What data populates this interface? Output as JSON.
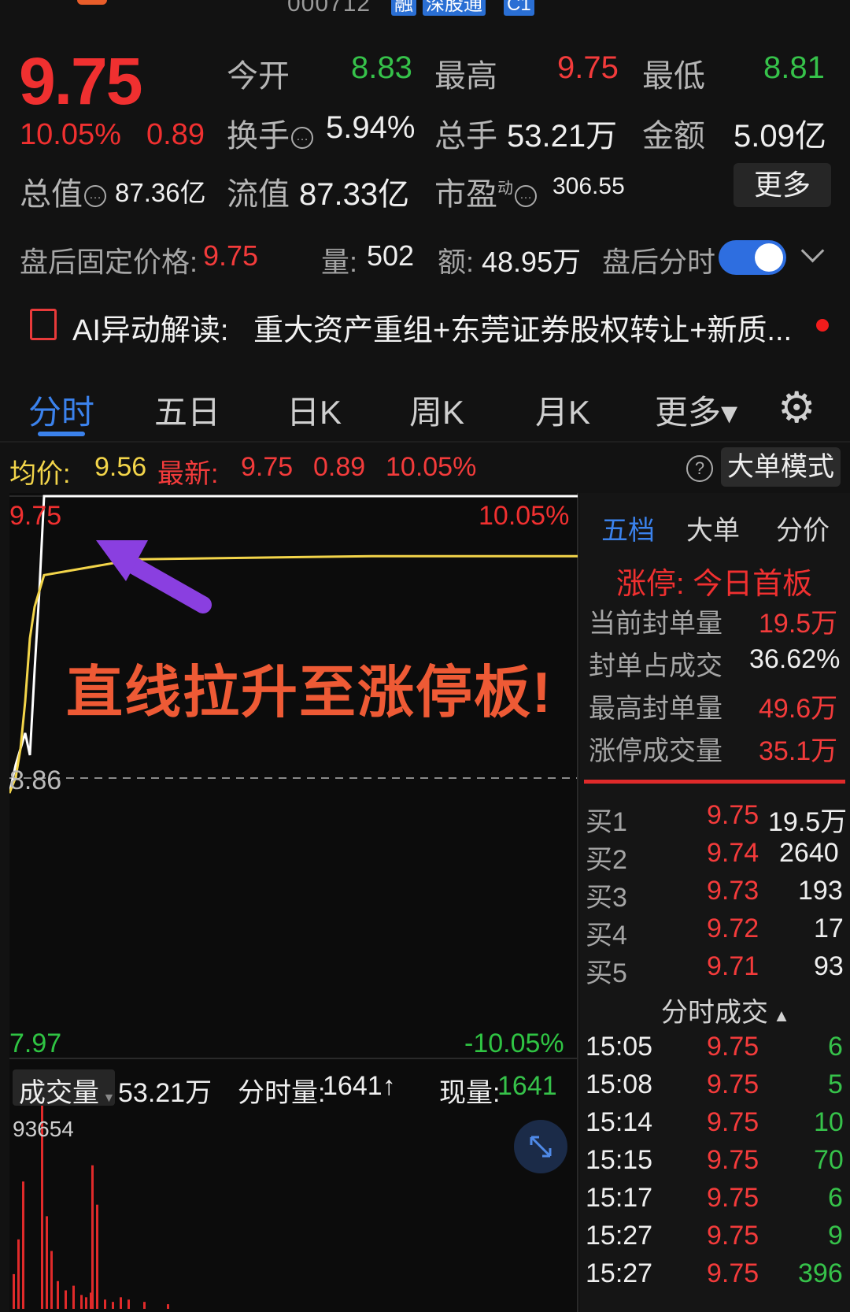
{
  "header": {
    "code": "000712",
    "tags": [
      "融",
      "深股通",
      "C1"
    ]
  },
  "quote": {
    "price": "9.75",
    "change_pct": "10.05%",
    "change": "0.89",
    "open_label": "今开",
    "open": "8.83",
    "high_label": "最高",
    "high": "9.75",
    "low_label": "最低",
    "low": "8.81",
    "turnover_label": "换手",
    "turnover": "5.94%",
    "volume_label": "总手",
    "volume": "53.21万",
    "amount_label": "金额",
    "amount": "5.09亿",
    "mktcap_label": "总值",
    "mktcap": "87.36亿",
    "float_label": "流值",
    "float": "87.33亿",
    "pe_label": "市盈",
    "pe_super": "动",
    "pe": "306.55",
    "more_label": "更多"
  },
  "after_hours": {
    "price_label": "盘后固定价格:",
    "price": "9.75",
    "vol_label": "量:",
    "vol": "502",
    "amt_label": "额:",
    "amt": "48.95万",
    "toggle_label": "盘后分时",
    "toggle_on": true
  },
  "ai": {
    "label": "AI异动解读:",
    "text": "重大资产重组+东莞证券股权转让+新质..."
  },
  "tabs": [
    "分时",
    "五日",
    "日K",
    "周K",
    "月K",
    "更多▾"
  ],
  "statbar": {
    "avg_label": "均价:",
    "avg": "9.56",
    "last_label": "最新:",
    "last": "9.75",
    "chg": "0.89",
    "pct": "10.05%",
    "mode_btn": "大单模式"
  },
  "chart_data": {
    "type": "line",
    "title": "",
    "y_max_label": "9.75",
    "y_max_pct": "10.05%",
    "y_mid_label": "8.86",
    "y_min_label": "7.97",
    "y_min_pct": "-10.05%",
    "ylim": [
      7.97,
      9.75
    ],
    "annotation": "直线拉升至涨停板!",
    "series": [
      {
        "name": "",
        "color": "#ffffff",
        "values": [
          8.81,
          8.9,
          8.95,
          9.0,
          8.93,
          9.2,
          9.45,
          9.75,
          9.75,
          9.75,
          9.75
        ]
      },
      {
        "name": "",
        "color": "#f3d54a",
        "values": [
          8.81,
          8.86,
          8.95,
          9.1,
          9.3,
          9.4,
          9.45,
          9.5,
          9.55,
          9.56,
          9.56
        ]
      }
    ],
    "volume": {
      "label": "成交量",
      "total": "53.21万",
      "period_label": "分时量:",
      "period": "1641↑",
      "current_label": "现量:",
      "current": "1641",
      "max": "93654"
    }
  },
  "panel": {
    "tabs": [
      "五档",
      "大单",
      "分价"
    ],
    "limit_title": "涨停: 今日首板",
    "limit_rows": [
      {
        "label": "当前封单量",
        "value": "19.5万",
        "red": true
      },
      {
        "label": "封单占成交",
        "value": "36.62%",
        "red": false
      },
      {
        "label": "最高封单量",
        "value": "49.6万",
        "red": true
      },
      {
        "label": "涨停成交量",
        "value": "35.1万",
        "red": true
      }
    ],
    "bids": [
      {
        "label": "买1",
        "price": "9.75",
        "qty": "19.5万"
      },
      {
        "label": "买2",
        "price": "9.74",
        "qty": "2640"
      },
      {
        "label": "买3",
        "price": "9.73",
        "qty": "193"
      },
      {
        "label": "买4",
        "price": "9.72",
        "qty": "17"
      },
      {
        "label": "买5",
        "price": "9.71",
        "qty": "93"
      }
    ],
    "ticks_title": "分时成交",
    "ticks": [
      {
        "time": "15:05",
        "price": "9.75",
        "qty": "6"
      },
      {
        "time": "15:08",
        "price": "9.75",
        "qty": "5"
      },
      {
        "time": "15:14",
        "price": "9.75",
        "qty": "10"
      },
      {
        "time": "15:15",
        "price": "9.75",
        "qty": "70"
      },
      {
        "time": "15:17",
        "price": "9.75",
        "qty": "6"
      },
      {
        "time": "15:27",
        "price": "9.75",
        "qty": "9"
      },
      {
        "time": "15:27",
        "price": "9.75",
        "qty": "396"
      }
    ]
  },
  "colors": {
    "up": "#f03030",
    "down": "#2fc443",
    "accent": "#3b82ec",
    "avg": "#f3d54a"
  }
}
